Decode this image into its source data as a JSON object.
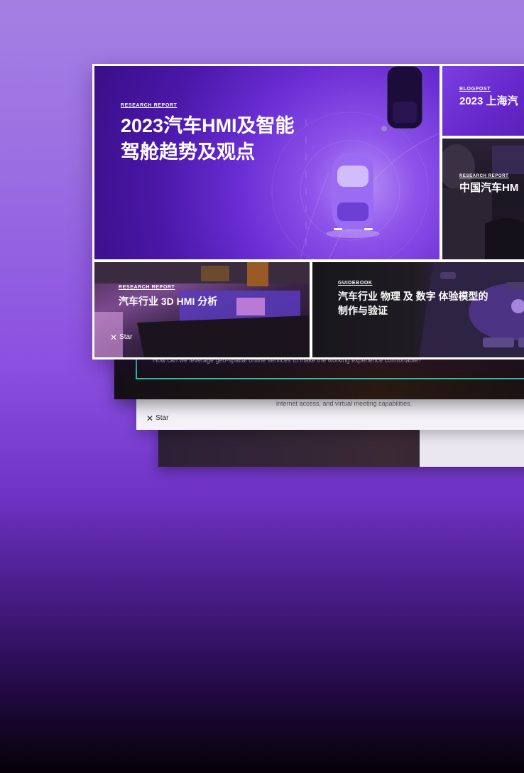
{
  "cards": {
    "hero": {
      "eyebrow": "RESEARCH REPORT",
      "title": "2023汽车HMI及智能驾舱趋势及观点"
    },
    "blog": {
      "eyebrow": "BLOGPOST",
      "title": "2023 上海汽"
    },
    "china": {
      "eyebrow": "RESEARCH REPORT",
      "title": "中国汽车HM"
    },
    "three_d": {
      "eyebrow": "RESEARCH REPORT",
      "title": "汽车行业 3D HMI 分析",
      "logo_text": "Star"
    },
    "guidebook": {
      "eyebrow": "GUIDEBOOK",
      "title": "汽车行业 物理 及 数字 体验模型的制作与验证"
    }
  },
  "back_layers": {
    "question": "How can we leverage geo-spatial online services to make the working experience comfortable?",
    "body": "internet access, and virtual meeting capabilities.",
    "logo_text": "Star"
  },
  "icons": {
    "logo": "star-logo-icon",
    "car": "car-icon"
  },
  "colors": {
    "accent": "#6a2ed4",
    "teal": "#34c2a8"
  }
}
